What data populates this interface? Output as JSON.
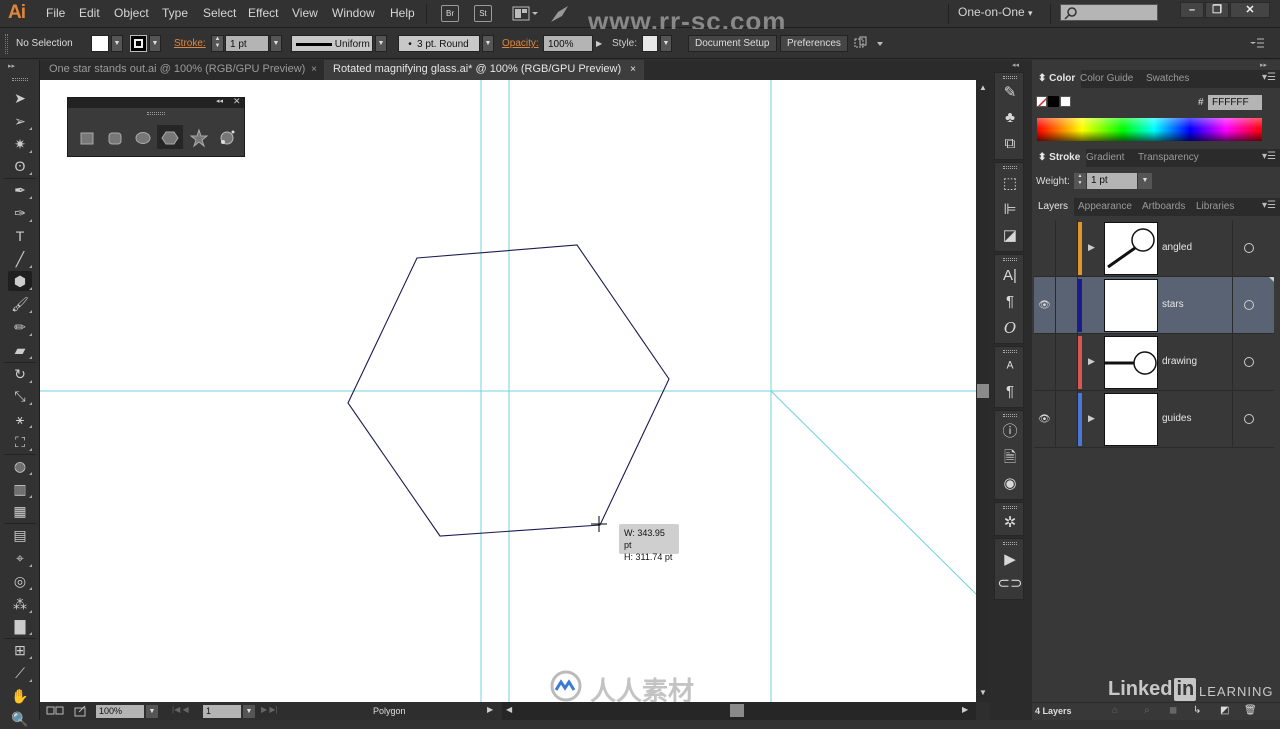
{
  "app": {
    "logo": "Ai",
    "watermark": "www.rr-sc.com"
  },
  "menubar": {
    "items": [
      "File",
      "Edit",
      "Object",
      "Type",
      "Select",
      "Effect",
      "View",
      "Window",
      "Help"
    ],
    "bridge_label": "Br",
    "stock_label": "St",
    "workspace": "One-on-One",
    "workspace_arrow": "▾",
    "search_placeholder": "",
    "minimize": "–",
    "restore": "❐",
    "close": "✕"
  },
  "controlbar": {
    "selection": "No Selection",
    "stroke_label": "Stroke:",
    "stroke_weight": "1 pt",
    "profile": "Uniform",
    "brush": "3 pt. Round",
    "opacity_label": "Opacity:",
    "opacity": "100%",
    "style_label": "Style:",
    "document_setup": "Document Setup",
    "preferences": "Preferences",
    "accent": "#e0863b"
  },
  "tabs": [
    {
      "title": "One star stands out.ai @ 100% (RGB/GPU Preview)",
      "close": "×",
      "active": false
    },
    {
      "title": "Rotated magnifying glass.ai* @ 100% (RGB/GPU Preview)",
      "close": "×",
      "active": true
    }
  ],
  "shape_flyout": {
    "collapse": "◂◂",
    "close": "✕",
    "tools": [
      "rectangle",
      "rounded-rectangle",
      "ellipse",
      "polygon",
      "star",
      "flare"
    ],
    "active": "polygon"
  },
  "toolbox": {
    "tools": [
      "selection",
      "direct-selection",
      "magic-wand",
      "lasso",
      "pen",
      "curvature",
      "type",
      "line-segment",
      "polygon",
      "paintbrush",
      "pencil",
      "eraser",
      "rotate",
      "scale",
      "puppet-warp",
      "free-transform",
      "shape-builder",
      "perspective-grid",
      "mesh",
      "gradient",
      "eyedropper",
      "blend",
      "symbol-sprayer",
      "column-graph",
      "artboard",
      "slice",
      "hand",
      "zoom"
    ],
    "active": "polygon"
  },
  "canvas": {
    "tooltip_w": "W: 343.95 pt",
    "tooltip_h": "H: 311.74 pt",
    "guide_color": "#6fd3dd",
    "path_color": "#1a1a50"
  },
  "statusbar": {
    "zoom": "100%",
    "artboard": "1",
    "tool_name": "Polygon"
  },
  "color_panel": {
    "tabs": [
      "Color",
      "Color Guide",
      "Swatches"
    ],
    "hex_label": "#",
    "hex_value": "FFFFFF"
  },
  "stroke_panel": {
    "tabs": [
      "Stroke",
      "Gradient",
      "Transparency"
    ],
    "weight_label": "Weight:",
    "weight_value": "1 pt"
  },
  "layers_panel": {
    "tabs": [
      "Layers",
      "Appearance",
      "Artboards",
      "Libraries"
    ],
    "layers": [
      {
        "name": "angled",
        "color": "#e0962a",
        "visible": false,
        "selected": false,
        "expandable": true,
        "thumb": "angled-glass"
      },
      {
        "name": "stars",
        "color": "#1b1b8c",
        "visible": true,
        "selected": true,
        "expandable": false,
        "thumb": "blank"
      },
      {
        "name": "drawing",
        "color": "#d9574f",
        "visible": false,
        "selected": false,
        "expandable": true,
        "thumb": "flat-glass"
      },
      {
        "name": "guides",
        "color": "#4a78d8",
        "visible": true,
        "selected": false,
        "expandable": true,
        "thumb": "blank"
      }
    ],
    "footer_count": "4 Layers"
  },
  "branding": {
    "linkedin": "Linked",
    "in": "in",
    "learning": "LEARNING",
    "rr_logo_text": "人人素材"
  }
}
